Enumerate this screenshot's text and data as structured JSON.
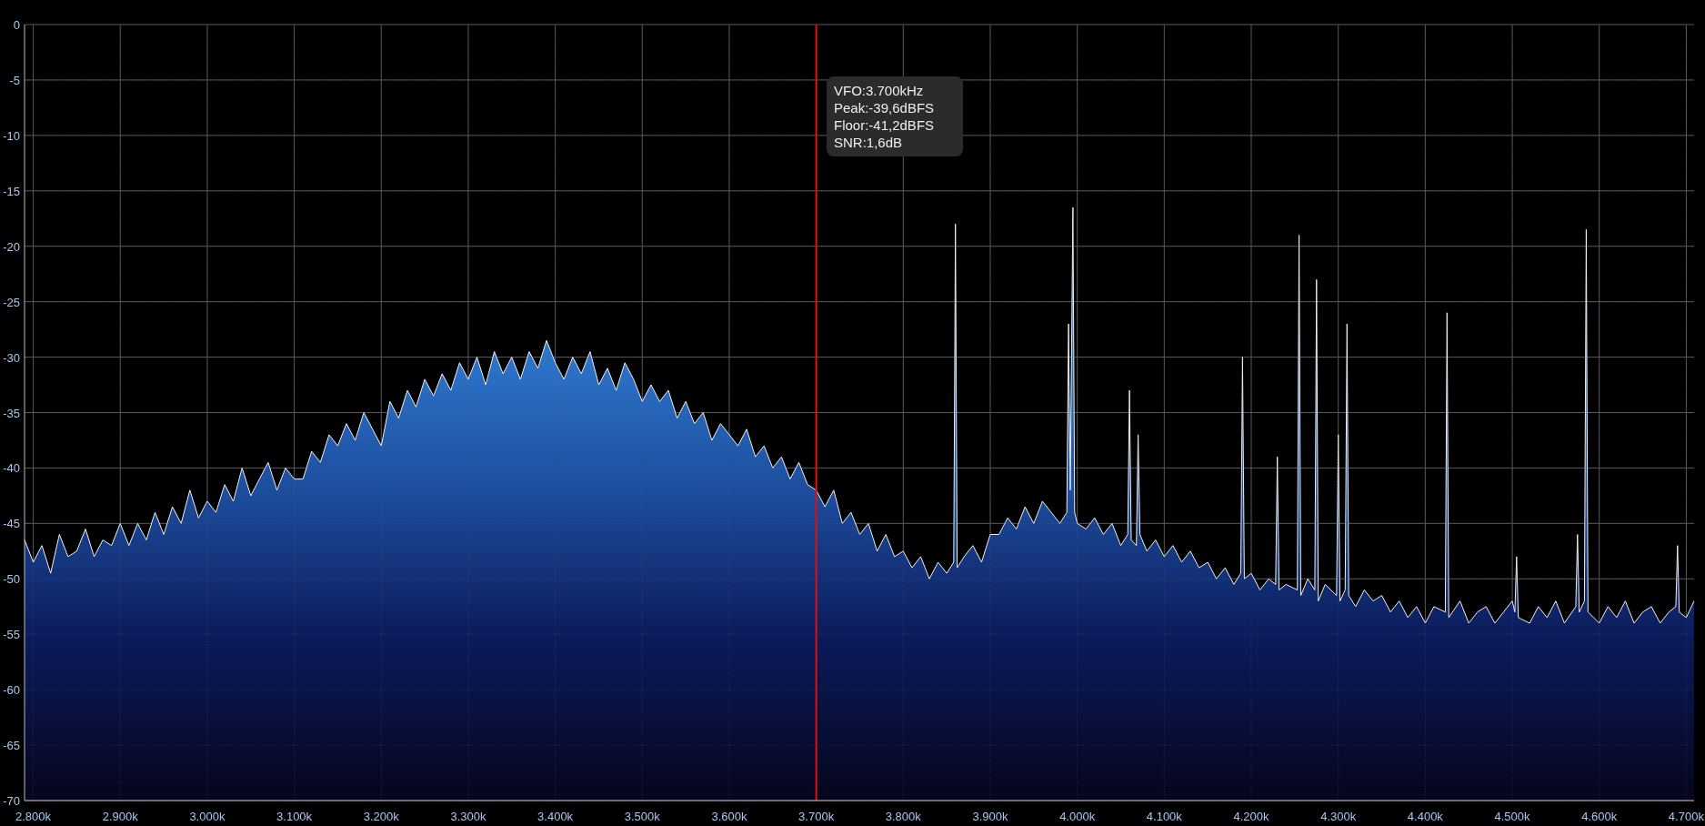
{
  "spectrum": {
    "chart_data": {
      "type": "area",
      "grid": true,
      "xlim": [
        2790,
        4709
      ],
      "ylim": [
        -70,
        0
      ],
      "ref_lines": [
        {
          "axis": "x",
          "value": 3700,
          "color": "#e01010"
        }
      ],
      "xticks": [
        {
          "value": 2800,
          "label": "2.800k"
        },
        {
          "value": 2900,
          "label": "2.900k"
        },
        {
          "value": 3000,
          "label": "3.000k"
        },
        {
          "value": 3100,
          "label": "3.100k"
        },
        {
          "value": 3200,
          "label": "3.200k"
        },
        {
          "value": 3300,
          "label": "3.300k"
        },
        {
          "value": 3400,
          "label": "3.400k"
        },
        {
          "value": 3500,
          "label": "3.500k"
        },
        {
          "value": 3600,
          "label": "3.600k"
        },
        {
          "value": 3700,
          "label": "3.700k"
        },
        {
          "value": 3800,
          "label": "3.800k"
        },
        {
          "value": 3900,
          "label": "3.900k"
        },
        {
          "value": 4000,
          "label": "4.000k"
        },
        {
          "value": 4100,
          "label": "4.100k"
        },
        {
          "value": 4200,
          "label": "4.200k"
        },
        {
          "value": 4300,
          "label": "4.300k"
        },
        {
          "value": 4400,
          "label": "4.400k"
        },
        {
          "value": 4500,
          "label": "4.500k"
        },
        {
          "value": 4600,
          "label": "4.600k"
        },
        {
          "value": 4700,
          "label": "4.700k"
        }
      ],
      "yticks": [
        0,
        -5,
        -10,
        -15,
        -20,
        -25,
        -30,
        -35,
        -40,
        -45,
        -50,
        -55,
        -60,
        -65,
        -70
      ],
      "x": [
        2790,
        2790,
        2800,
        2810,
        2820,
        2830,
        2840,
        2850,
        2860,
        2870,
        2880,
        2890,
        2900,
        2910,
        2920,
        2930,
        2940,
        2950,
        2960,
        2970,
        2980,
        2990,
        3000,
        3010,
        3020,
        3030,
        3040,
        3050,
        3060,
        3070,
        3080,
        3090,
        3100,
        3110,
        3120,
        3130,
        3140,
        3150,
        3160,
        3170,
        3180,
        3190,
        3200,
        3210,
        3220,
        3230,
        3240,
        3250,
        3260,
        3270,
        3280,
        3290,
        3300,
        3310,
        3320,
        3330,
        3340,
        3350,
        3360,
        3370,
        3380,
        3390,
        3400,
        3410,
        3420,
        3430,
        3440,
        3450,
        3460,
        3470,
        3480,
        3490,
        3500,
        3510,
        3520,
        3530,
        3540,
        3550,
        3560,
        3570,
        3580,
        3590,
        3600,
        3610,
        3620,
        3630,
        3640,
        3650,
        3660,
        3670,
        3680,
        3690,
        3700,
        3710,
        3720,
        3730,
        3740,
        3750,
        3760,
        3770,
        3780,
        3790,
        3800,
        3810,
        3820,
        3830,
        3840,
        3850,
        3858,
        3860,
        3862,
        3870,
        3880,
        3890,
        3900,
        3910,
        3920,
        3930,
        3940,
        3950,
        3960,
        3970,
        3980,
        3988,
        3990,
        3992,
        3995,
        3997,
        4000,
        4010,
        4020,
        4030,
        4040,
        4050,
        4058,
        4060,
        4062,
        4068,
        4070,
        4072,
        4080,
        4090,
        4100,
        4110,
        4120,
        4130,
        4140,
        4150,
        4160,
        4170,
        4180,
        4188,
        4190,
        4192,
        4200,
        4210,
        4220,
        4228,
        4230,
        4232,
        4240,
        4253,
        4255,
        4257,
        4265,
        4273,
        4275,
        4277,
        4285,
        4298,
        4300,
        4302,
        4308,
        4310,
        4312,
        4320,
        4330,
        4340,
        4350,
        4360,
        4370,
        4380,
        4390,
        4400,
        4410,
        4423,
        4425,
        4427,
        4440,
        4450,
        4460,
        4470,
        4480,
        4490,
        4500,
        4503,
        4505,
        4507,
        4520,
        4530,
        4540,
        4550,
        4560,
        4573,
        4575,
        4577,
        4583,
        4585,
        4587,
        4600,
        4610,
        4620,
        4630,
        4640,
        4650,
        4660,
        4670,
        4680,
        4688,
        4690,
        4692,
        4700,
        4709,
        4709
      ],
      "series": [
        {
          "color": "#f0f0f0",
          "values": [
            -70,
            -46.5,
            -48.5,
            -47,
            -49.5,
            -46,
            -48,
            -47.5,
            -45.5,
            -48,
            -46.5,
            -47,
            -45,
            -47,
            -45,
            -46.5,
            -44,
            -46,
            -43.5,
            -45,
            -42,
            -44.5,
            -43,
            -44,
            -41.5,
            -43,
            -40,
            -42.5,
            -41,
            -39.5,
            -42,
            -40,
            -41,
            -41,
            -38.5,
            -39.5,
            -37,
            -38,
            -36,
            -37.5,
            -35,
            -36.5,
            -38,
            -34,
            -35.5,
            -33,
            -34.5,
            -32,
            -33.5,
            -31.5,
            -33,
            -30.5,
            -32,
            -30,
            -32.5,
            -29.5,
            -31.5,
            -30,
            -32,
            -29.5,
            -31,
            -28.5,
            -30.5,
            -32,
            -30,
            -31.5,
            -29.5,
            -32.5,
            -31,
            -33,
            -30.5,
            -32,
            -34,
            -32.5,
            -34,
            -33,
            -35.5,
            -34,
            -36,
            -35,
            -37.5,
            -36,
            -37,
            -38,
            -36.5,
            -39,
            -38,
            -40,
            -39,
            -41,
            -39.5,
            -41.5,
            -42,
            -43.5,
            -42,
            -45,
            -44,
            -46,
            -45,
            -47.5,
            -46,
            -48,
            -47.5,
            -49,
            -48,
            -50,
            -48.5,
            -49.5,
            -48.5,
            -18,
            -49,
            -48,
            -47,
            -48.5,
            -46,
            -46,
            -44.5,
            -45.5,
            -43.5,
            -45,
            -43,
            -44,
            -45,
            -44,
            -27,
            -42,
            -16.5,
            -44,
            -45,
            -45.5,
            -44.5,
            -46,
            -45,
            -47,
            -46,
            -33,
            -46.5,
            -47,
            -37,
            -46,
            -47.5,
            -46.5,
            -48,
            -47,
            -48.5,
            -47.5,
            -49,
            -48.5,
            -50,
            -49,
            -50.5,
            -49.5,
            -30,
            -50,
            -49.5,
            -51,
            -50,
            -50.5,
            -39,
            -51,
            -50.5,
            -51,
            -19,
            -51.5,
            -50,
            -51,
            -23,
            -52,
            -50.5,
            -51.5,
            -37,
            -52,
            -51,
            -27,
            -51.5,
            -52.5,
            -51,
            -52,
            -51.5,
            -53,
            -52,
            -53.5,
            -52.5,
            -54,
            -52.5,
            -53,
            -26,
            -53.5,
            -52,
            -54,
            -53,
            -52.5,
            -54,
            -53,
            -52,
            -53,
            -48,
            -53.5,
            -54,
            -52.5,
            -53.5,
            -52,
            -54,
            -52.5,
            -46,
            -53,
            -52,
            -18.5,
            -53,
            -54,
            -52.5,
            -53.5,
            -52,
            -54,
            -53,
            -52.5,
            -54,
            -53,
            -52.5,
            -47,
            -53,
            -53.5,
            -52,
            -70
          ]
        }
      ]
    }
  },
  "vfo_tooltip": {
    "lines": [
      "VFO:3.700kHz",
      "Peak:-39,6dBFS",
      "Floor:-41,2dBFS",
      "SNR:1,6dB"
    ]
  }
}
